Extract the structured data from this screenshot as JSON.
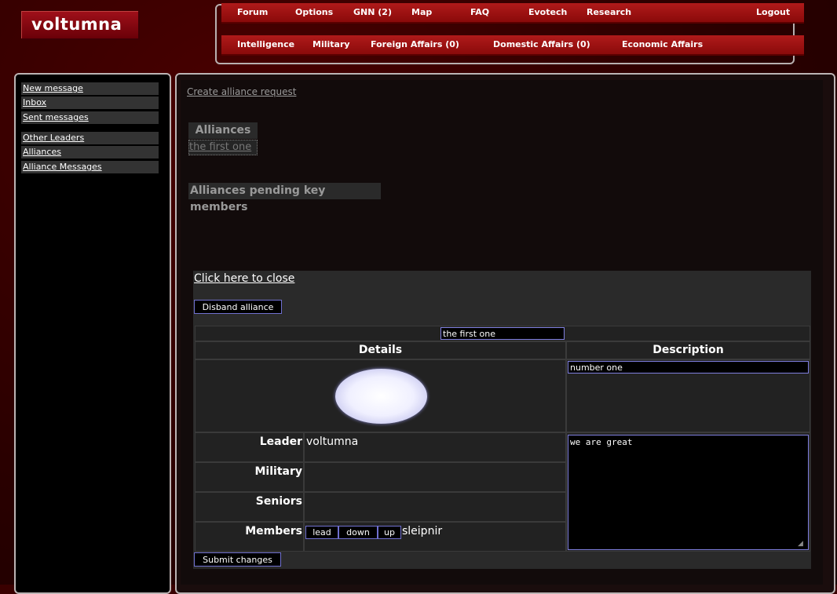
{
  "app": {
    "logo": "voltumna"
  },
  "nav": {
    "row1": [
      "Forum",
      "Options",
      "GNN (2)",
      "Map",
      "FAQ",
      "Evotech",
      "Research",
      "Logout"
    ],
    "row2": [
      "Intelligence",
      "Military",
      "Foreign Affairs (0)",
      "Domestic Affairs (0)",
      "Economic Affairs"
    ]
  },
  "sidebar": {
    "items": [
      "New message",
      "Inbox",
      "Sent messages",
      "Other Leaders",
      "Alliances",
      "Alliance Messages"
    ]
  },
  "main": {
    "create_link": "Create alliance request",
    "alliances_heading": "Alliances",
    "alliances_list": [
      "the first one"
    ],
    "pending_heading": "Alliances pending key members"
  },
  "panel": {
    "close_link": "Click here to close",
    "disband_button": "Disband alliance",
    "alliance_name": "the first one",
    "details_heading": "Details",
    "description_heading": "Description",
    "description_short": "number one",
    "description_long": "we are great",
    "rows": {
      "leader_label": "Leader",
      "leader_value": "voltumna",
      "military_label": "Military",
      "seniors_label": "Seniors",
      "members_label": "Members",
      "member_name": "sleipnir",
      "member_buttons": [
        "lead",
        "down",
        "up"
      ]
    },
    "submit_button": "Submit changes"
  },
  "colors": {
    "nav": "#a01010",
    "background": "#3a0000",
    "input_border": "#8080e0"
  }
}
